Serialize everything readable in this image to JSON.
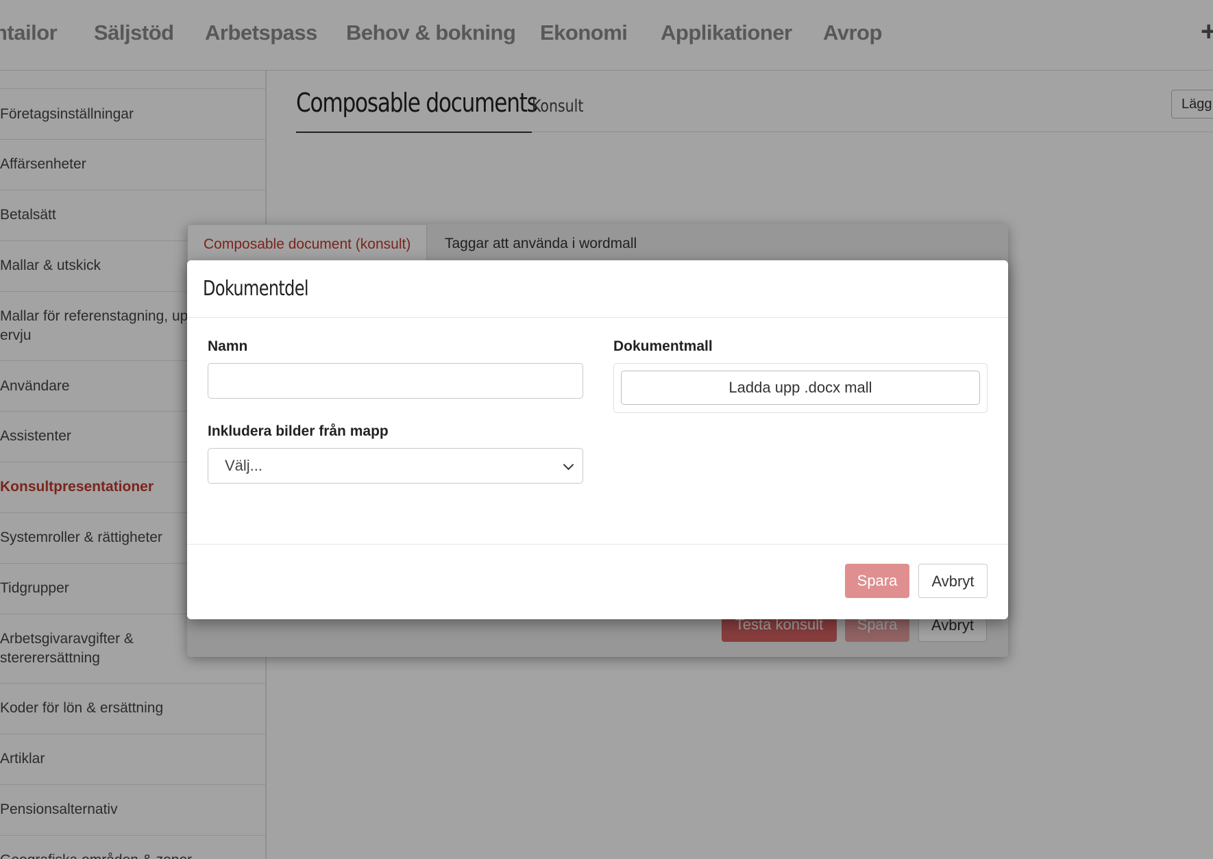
{
  "top_nav": {
    "items": [
      "ntailor",
      "Säljstöd",
      "Arbetspass",
      "Behov & bokning",
      "Ekonomi",
      "Applikationer",
      "Avrop"
    ],
    "plus_label": "+"
  },
  "sidebar": {
    "items": [
      {
        "label": "Företagsinställningar"
      },
      {
        "label": "Affärsenheter"
      },
      {
        "label": "Betalsätt"
      },
      {
        "label": "Mallar & utskick"
      },
      {
        "label": "Mallar för referenstagning, upp\nervju"
      },
      {
        "label": "Användare"
      },
      {
        "label": "Assistenter"
      },
      {
        "label": "Konsultpresentationer"
      },
      {
        "label": "Systemroller & rättigheter"
      },
      {
        "label": "Tidgrupper"
      },
      {
        "label": "Arbetsgivaravgifter &\nstererersättning"
      },
      {
        "label": "Koder för lön & ersättning"
      },
      {
        "label": "Artiklar"
      },
      {
        "label": "Pensionsalternativ"
      },
      {
        "label": "Geografiska områden & zoner"
      }
    ],
    "active": "Konsultpresentationer"
  },
  "main": {
    "title": "Composable documents",
    "subtitle": "Konsult",
    "add_button": "Lägg"
  },
  "outer_modal": {
    "tabs": [
      {
        "label": "Composable document (konsult)",
        "active": true
      },
      {
        "label": "Taggar att använda i wordmall",
        "active": false
      }
    ],
    "footer": {
      "test_button": "Testa konsult",
      "save_button": "Spara",
      "cancel_button": "Avbryt"
    }
  },
  "inner_modal": {
    "title": "Dokumentdel",
    "name_label": "Namn",
    "name_value": "",
    "template_label": "Dokumentmall",
    "upload_button": "Ladda upp .docx mall",
    "images_label": "Inkludera bilder från mapp",
    "images_select_value": "Välj...",
    "save_button": "Spara",
    "cancel_button": "Avbryt"
  },
  "colors": {
    "accent": "#c0392b",
    "save_button": "#df8f8f",
    "testa_button": "#d56060"
  }
}
